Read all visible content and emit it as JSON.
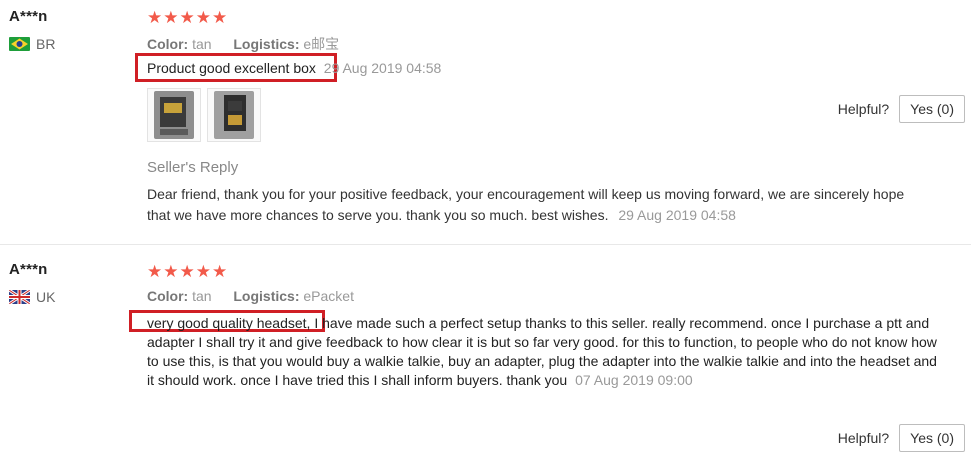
{
  "reviews": [
    {
      "user": "A***n",
      "country_code": "BR",
      "flag_icon": "brazil-flag-icon",
      "stars": "★★★★★",
      "color_label": "Color:",
      "color_value": "tan",
      "logistics_label": "Logistics:",
      "logistics_value": "e邮宝",
      "highlighted_text": "Product good excellent box",
      "body_text": "",
      "date": "29 Aug 2019 04:58",
      "photos": [
        "product-photo-1",
        "product-photo-2"
      ],
      "helpful_label": "Helpful?",
      "yes_label": "Yes (0)",
      "seller_reply": {
        "title": "Seller's Reply",
        "text": "Dear friend, thank you for your positive feedback, your encouragement will keep us moving forward, we are sincerely hope that we have more chances to serve you. thank you so much. best wishes.",
        "date": "29 Aug 2019 04:58"
      }
    },
    {
      "user": "A***n",
      "country_code": "UK",
      "flag_icon": "uk-flag-icon",
      "stars": "★★★★★",
      "color_label": "Color:",
      "color_value": "tan",
      "logistics_label": "Logistics:",
      "logistics_value": "ePacket",
      "highlighted_text": "very good quality headset,",
      "body_text": " I have made such a perfect setup thanks to this seller. really recommend. once I purchase a ptt and adapter I shall try it and give feedback to how clear it is but so far very good. for this to function, to people who do not know how to use this, is that you would buy a walkie talkie, buy an adapter, plug the adapter into the walkie talkie and into the headset and it should work. once I have tried this I shall inform buyers. thank you",
      "date": "07 Aug 2019 09:00",
      "helpful_label": "Helpful?",
      "yes_label": "Yes (0)"
    }
  ],
  "colors": {
    "star": "#f25a4a",
    "highlight_border": "#d01f25",
    "muted_text": "#999999"
  }
}
